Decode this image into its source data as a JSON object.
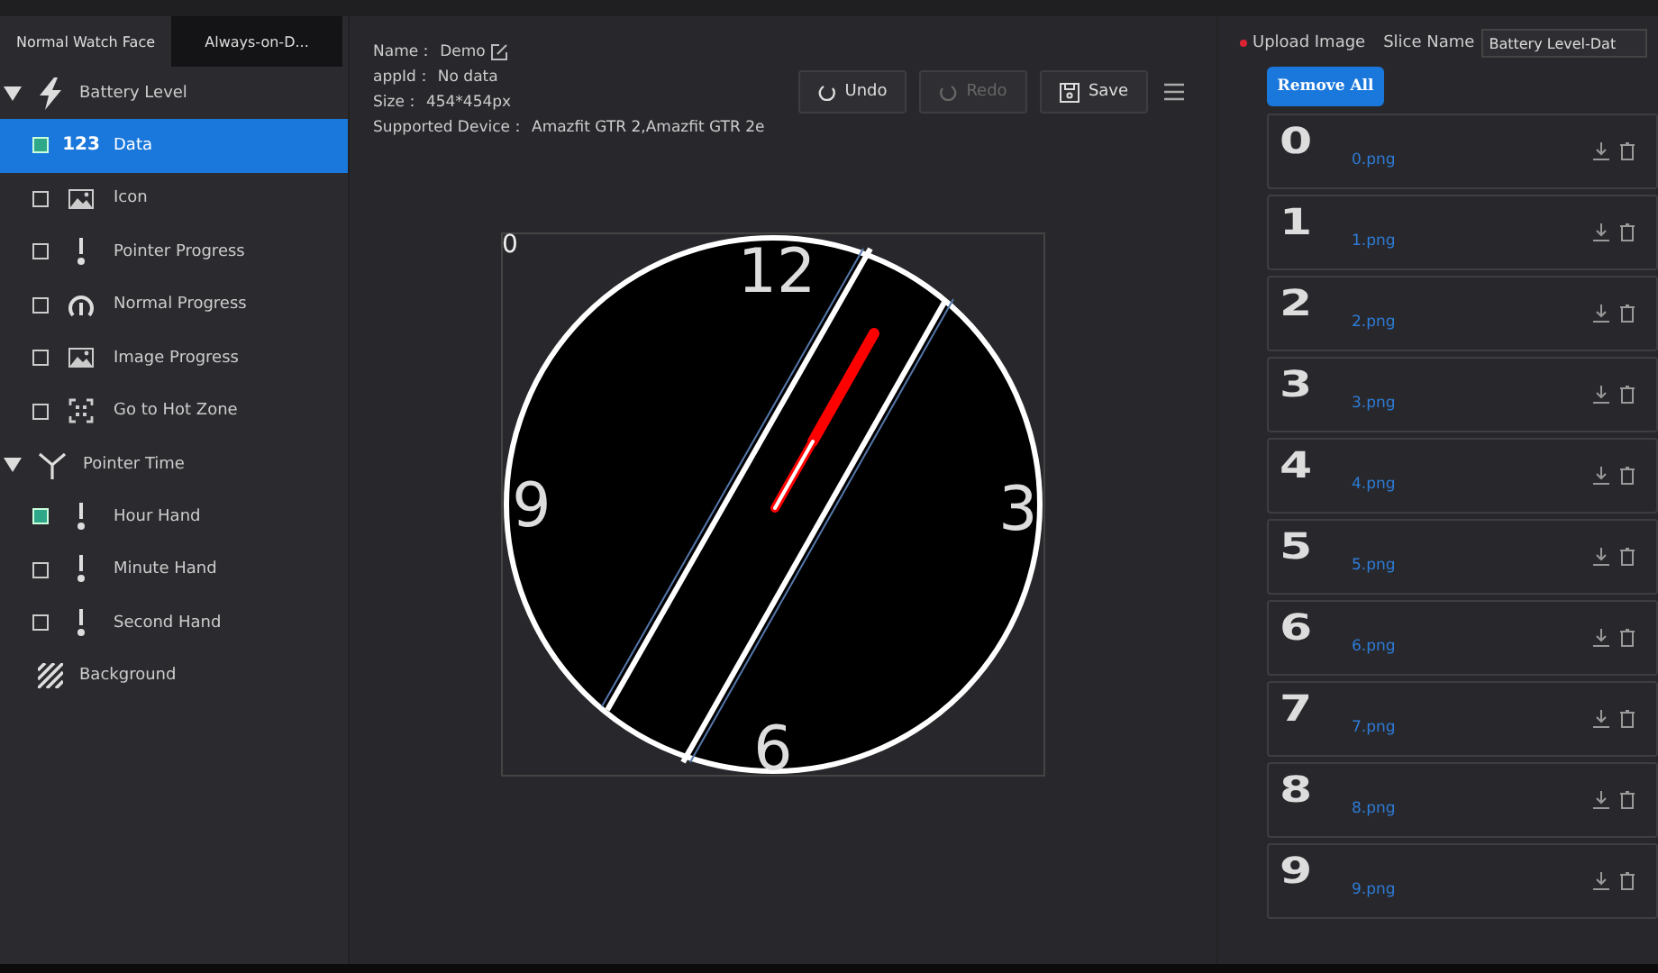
{
  "tabs": [
    {
      "label": "Normal Watch Face",
      "selected": true
    },
    {
      "label": "Always-on-D...",
      "selected": false
    }
  ],
  "tree": [
    {
      "label": "Battery Level",
      "kind": "bolt",
      "expanded": true,
      "children": [
        {
          "label": "Data",
          "kind": "data",
          "badge": "123",
          "checked": true,
          "selected": true
        },
        {
          "label": "Icon",
          "kind": "image",
          "checked": false,
          "selected": false
        },
        {
          "label": "Pointer Progress",
          "kind": "pointer",
          "checked": false,
          "selected": false
        },
        {
          "label": "Normal Progress",
          "kind": "arc",
          "checked": false,
          "selected": false
        },
        {
          "label": "Image Progress",
          "kind": "image",
          "checked": false,
          "selected": false
        },
        {
          "label": "Go to Hot Zone",
          "kind": "hotzone",
          "checked": false,
          "selected": false
        }
      ]
    },
    {
      "label": "Pointer Time",
      "kind": "hands",
      "expanded": true,
      "children": [
        {
          "label": "Hour Hand",
          "kind": "pointer",
          "checked": true,
          "selected": false
        },
        {
          "label": "Minute Hand",
          "kind": "pointer",
          "checked": false,
          "selected": false
        },
        {
          "label": "Second Hand",
          "kind": "pointer",
          "checked": false,
          "selected": false
        }
      ]
    },
    {
      "label": "Background",
      "kind": "background"
    }
  ],
  "info": [
    {
      "label": "Name：",
      "value": "Demo",
      "editable": true
    },
    {
      "label": "appId：",
      "value": "No data",
      "editable": false
    },
    {
      "label": "Size：",
      "value": "454*454px",
      "editable": false
    },
    {
      "label": "Supported Device：",
      "value": "Amazfit GTR 2,Amazfit GTR 2e",
      "editable": false
    }
  ],
  "toolbar": [
    {
      "label": "Undo",
      "kind": "undo",
      "disabled": false
    },
    {
      "label": "Redo",
      "kind": "redo",
      "disabled": true
    },
    {
      "label": "Save",
      "kind": "save",
      "disabled": false
    }
  ],
  "preview": {
    "data_text": "0",
    "numerals": [
      "12",
      "3",
      "6",
      "9"
    ]
  },
  "upload": {
    "label": "Upload Image",
    "required": true,
    "slice_label": "Slice Name",
    "slice_value": "Battery Level-Dat",
    "remove_all": "Remove All"
  },
  "slices": [
    {
      "glyph": "0",
      "file": "0.png"
    },
    {
      "glyph": "1",
      "file": "1.png"
    },
    {
      "glyph": "2",
      "file": "2.png"
    },
    {
      "glyph": "3",
      "file": "3.png"
    },
    {
      "glyph": "4",
      "file": "4.png"
    },
    {
      "glyph": "5",
      "file": "5.png"
    },
    {
      "glyph": "6",
      "file": "6.png"
    },
    {
      "glyph": "7",
      "file": "7.png"
    },
    {
      "glyph": "8",
      "file": "8.png"
    },
    {
      "glyph": "9",
      "file": "9.png"
    }
  ]
}
